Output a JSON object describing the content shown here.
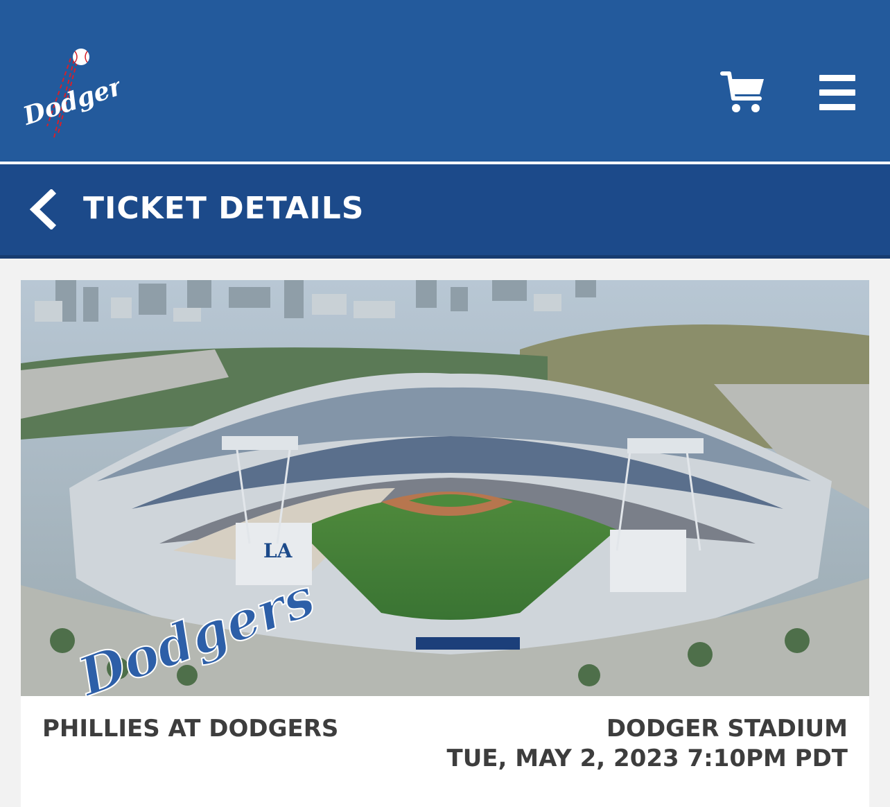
{
  "app": {
    "brand": "Dodgers",
    "logo_icon": "dodgers-logo",
    "cart_icon": "cart-icon",
    "menu_icon": "hamburger-menu-icon"
  },
  "header": {
    "back_icon": "chevron-left-icon",
    "title": "TICKET DETAILS"
  },
  "event": {
    "image_alt": "Aerial view of Dodger Stadium",
    "stadium_sign": "Dodgers",
    "name": "PHILLIES AT DODGERS",
    "venue": "DODGER STADIUM",
    "datetime": "TUE, MAY 2, 2023 7:10PM PDT"
  },
  "colors": {
    "topbar": "#235a9c",
    "subbar": "#1c4a8a",
    "logo_ball_seams": "#d6202a",
    "text_dark": "#3d3d3d"
  }
}
